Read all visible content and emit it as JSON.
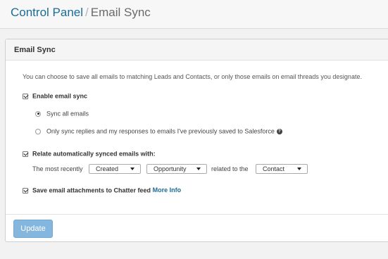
{
  "breadcrumb": {
    "root": "Control Panel",
    "separator": "/",
    "current": "Email Sync"
  },
  "panel": {
    "title": "Email Sync",
    "description": "You can choose to save all emails to matching Leads and Contacts, or only those emails on email threads you designate."
  },
  "options": {
    "enable_sync": {
      "label": "Enable email sync",
      "checked": true
    },
    "sync_all": {
      "label": "Sync all emails",
      "selected": true
    },
    "sync_replies": {
      "label": "Only sync replies and my responses to emails I've previously saved to Salesforce",
      "selected": false,
      "help_icon": "?"
    },
    "relate": {
      "label": "Relate automatically synced emails with:",
      "checked": true
    },
    "relate_row": {
      "prefix": "The most recently",
      "select1": "Created",
      "select2": "Opportunity",
      "middle": "related to the",
      "select3": "Contact"
    },
    "attachments": {
      "label": "Save email attachments to Chatter feed",
      "checked": true,
      "link": "More Info"
    }
  },
  "buttons": {
    "update": "Update"
  },
  "colors": {
    "link": "#1a6c97",
    "button": "#85b7de"
  }
}
